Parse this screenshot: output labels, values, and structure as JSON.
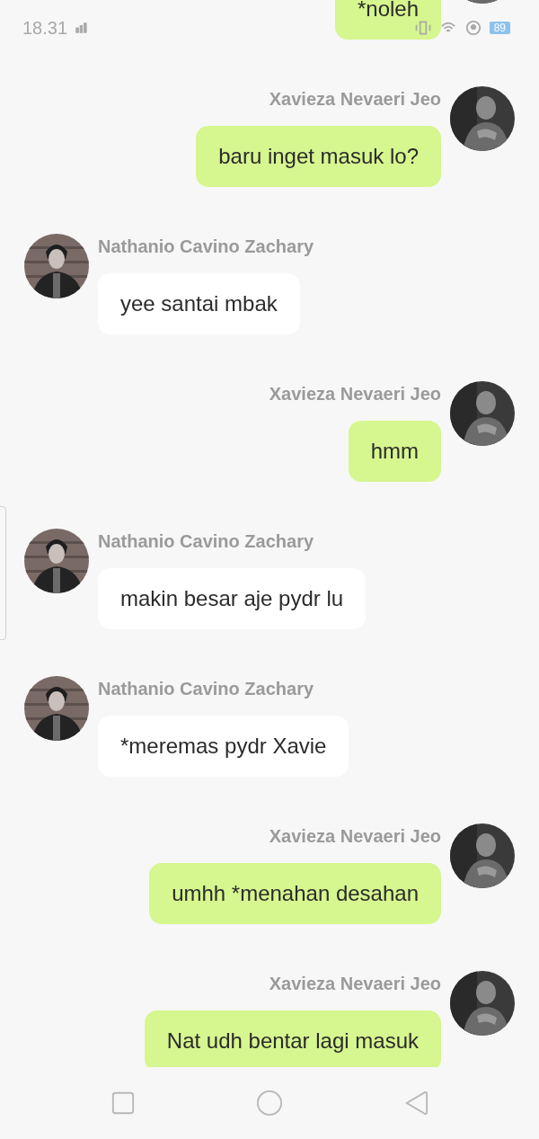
{
  "status_bar": {
    "time": "18.31",
    "battery": "89"
  },
  "messages": [
    {
      "kind": "sent",
      "text": "*noleh"
    },
    {
      "kind": "sent",
      "name": "Xavieza Nevaeri Jeo",
      "text": "baru inget masuk lo?"
    },
    {
      "kind": "received",
      "name": "Nathanio Cavino Zachary",
      "text": "yee santai mbak"
    },
    {
      "kind": "sent",
      "name": "Xavieza Nevaeri Jeo",
      "text": "hmm"
    },
    {
      "kind": "received",
      "name": "Nathanio Cavino Zachary",
      "text": "makin besar aje pydr lu"
    },
    {
      "kind": "received",
      "name": "Nathanio Cavino Zachary",
      "text": "*meremas pydr Xavie"
    },
    {
      "kind": "sent",
      "name": "Xavieza Nevaeri Jeo",
      "text": "umhh *menahan desahan"
    },
    {
      "kind": "sent",
      "name": "Xavieza Nevaeri Jeo",
      "text": "Nat udh bentar lagi masuk"
    }
  ]
}
